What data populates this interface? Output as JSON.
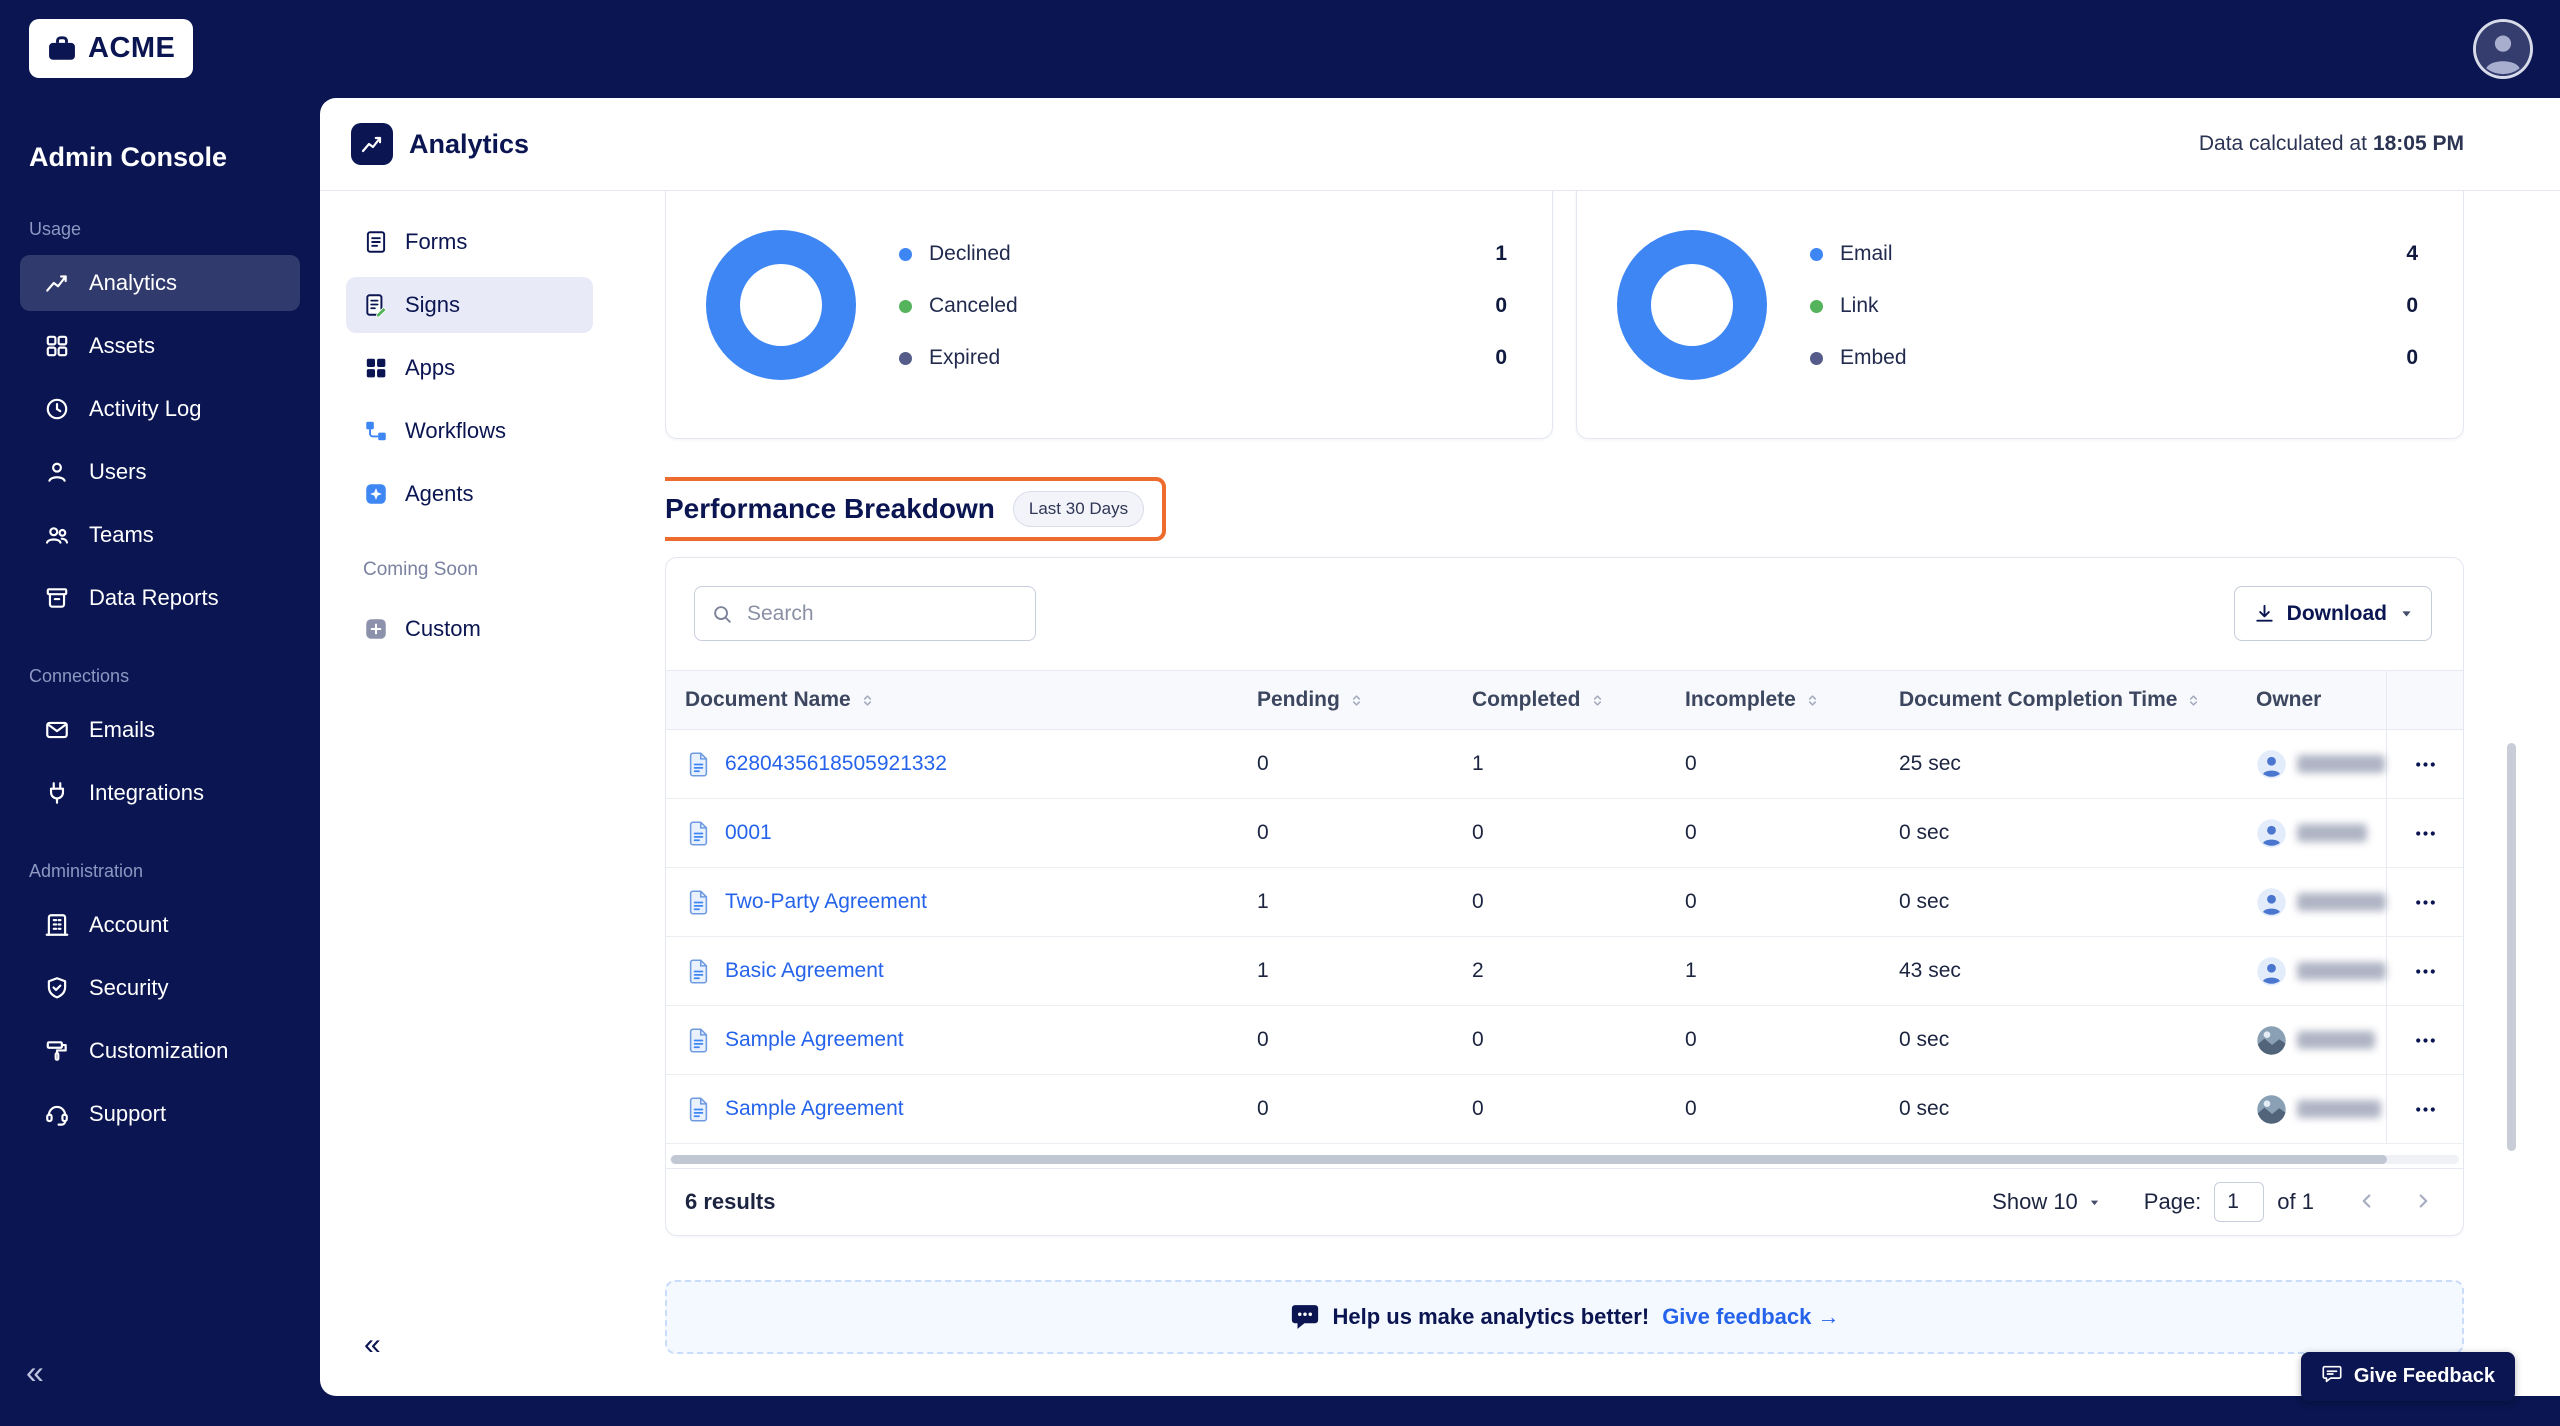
{
  "brand": {
    "logo_text": "ACME"
  },
  "topbar": {
    "avatar_icon": "user-avatar-icon"
  },
  "colors": {
    "navy": "#0A1551",
    "donut_blue": "#3E86F4",
    "link_blue": "#2563EB",
    "annotation_orange": "#ED6B2D",
    "green": "#55B45B",
    "muted_purple": "#565C89"
  },
  "sidebar": {
    "title": "Admin Console",
    "collapse_glyph": "«",
    "sections": [
      {
        "label": "Usage",
        "items": [
          {
            "label": "Analytics",
            "icon": "analytics-icon",
            "selected": true
          },
          {
            "label": "Assets",
            "icon": "assets-icon"
          },
          {
            "label": "Activity Log",
            "icon": "activity-log-icon"
          },
          {
            "label": "Users",
            "icon": "users-icon"
          },
          {
            "label": "Teams",
            "icon": "teams-icon"
          },
          {
            "label": "Data Reports",
            "icon": "data-reports-icon"
          }
        ]
      },
      {
        "label": "Connections",
        "items": [
          {
            "label": "Emails",
            "icon": "emails-icon"
          },
          {
            "label": "Integrations",
            "icon": "integrations-icon"
          }
        ]
      },
      {
        "label": "Administration",
        "items": [
          {
            "label": "Account",
            "icon": "account-icon"
          },
          {
            "label": "Security",
            "icon": "security-icon"
          },
          {
            "label": "Customization",
            "icon": "customization-icon"
          },
          {
            "label": "Support",
            "icon": "support-icon"
          }
        ]
      }
    ]
  },
  "header": {
    "icon": "analytics-chart-icon",
    "title": "Analytics",
    "calculated_prefix": "Data calculated at",
    "calculated_time": "18:05 PM"
  },
  "subnav": {
    "items": [
      {
        "label": "Forms",
        "icon": "forms-icon"
      },
      {
        "label": "Signs",
        "icon": "signs-icon",
        "selected": true
      },
      {
        "label": "Apps",
        "icon": "apps-icon"
      },
      {
        "label": "Workflows",
        "icon": "workflows-icon"
      },
      {
        "label": "Agents",
        "icon": "agents-icon"
      }
    ],
    "coming_soon_label": "Coming Soon",
    "coming_soon_items": [
      {
        "label": "Custom",
        "icon": "custom-icon"
      }
    ],
    "collapse_glyph": "«"
  },
  "chart_data": [
    {
      "type": "donut",
      "ring_color": "#3E86F4",
      "legend_position": "right",
      "segments": [
        {
          "label": "Declined",
          "value": 1,
          "color": "#3E86F4"
        },
        {
          "label": "Canceled",
          "value": 0,
          "color": "#55B45B"
        },
        {
          "label": "Expired",
          "value": 0,
          "color": "#565C89"
        }
      ]
    },
    {
      "type": "donut",
      "ring_color": "#3E86F4",
      "legend_position": "right",
      "segments": [
        {
          "label": "Email",
          "value": 4,
          "color": "#3E86F4"
        },
        {
          "label": "Link",
          "value": 0,
          "color": "#55B45B"
        },
        {
          "label": "Embed",
          "value": 0,
          "color": "#565C89"
        }
      ]
    }
  ],
  "performance": {
    "title": "Performance Breakdown",
    "badge": "Last 30 Days"
  },
  "table": {
    "search_placeholder": "Search",
    "download_label": "Download",
    "columns": [
      {
        "label": "Document Name",
        "sortable": true
      },
      {
        "label": "Pending",
        "sortable": true
      },
      {
        "label": "Completed",
        "sortable": true
      },
      {
        "label": "Incomplete",
        "sortable": true
      },
      {
        "label": "Document Completion Time",
        "sortable": true
      },
      {
        "label": "Owner",
        "sortable": false
      }
    ],
    "rows": [
      {
        "name": "6280435618505921332",
        "pending": "0",
        "completed": "1",
        "incomplete": "0",
        "completion_time": "25 sec",
        "owner_redacted": true,
        "avatar": "person"
      },
      {
        "name": "0001",
        "pending": "0",
        "completed": "0",
        "incomplete": "0",
        "completion_time": "0 sec",
        "owner_redacted": true,
        "avatar": "person"
      },
      {
        "name": "Two-Party Agreement",
        "pending": "1",
        "completed": "0",
        "incomplete": "0",
        "completion_time": "0 sec",
        "owner_redacted": true,
        "avatar": "person"
      },
      {
        "name": "Basic Agreement",
        "pending": "1",
        "completed": "2",
        "incomplete": "1",
        "completion_time": "43 sec",
        "owner_redacted": true,
        "avatar": "person"
      },
      {
        "name": "Sample Agreement",
        "pending": "0",
        "completed": "0",
        "incomplete": "0",
        "completion_time": "0 sec",
        "owner_redacted": true,
        "avatar": "photo"
      },
      {
        "name": "Sample Agreement",
        "pending": "0",
        "completed": "0",
        "incomplete": "0",
        "completion_time": "0 sec",
        "owner_redacted": true,
        "avatar": "photo"
      }
    ],
    "footer": {
      "results": "6 results",
      "show_label": "Show 10",
      "page_label": "Page:",
      "page_value": "1",
      "of_label": "of 1"
    }
  },
  "feedback_banner": {
    "icon": "chat-filled-icon",
    "text": "Help us make analytics better!",
    "link_label": "Give feedback →"
  },
  "feedback_button": {
    "icon": "chat-outline-icon",
    "label": "Give Feedback"
  }
}
